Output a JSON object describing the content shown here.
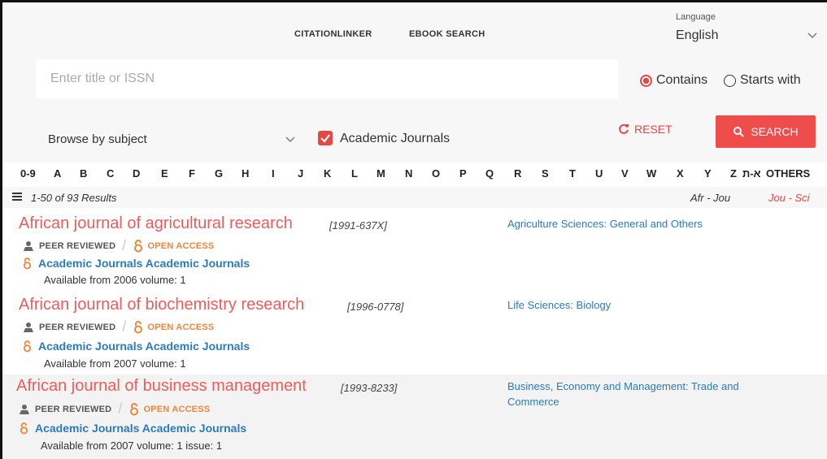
{
  "topnav": {
    "citationlinker": "CITATIONLINKER",
    "ebook_search": "EBOOK SEARCH"
  },
  "language": {
    "label": "Language",
    "value": "English"
  },
  "search": {
    "placeholder": "Enter title or ISSN",
    "radio_contains": "Contains",
    "radio_starts": "Starts with",
    "selected": "Contains"
  },
  "filters": {
    "subject_label": "Browse by subject",
    "academic_journals": "Academic Journals",
    "academic_checked": true
  },
  "actions": {
    "reset": "RESET",
    "search": "SEARCH"
  },
  "alphabet": [
    "0-9",
    "A",
    "B",
    "C",
    "D",
    "E",
    "F",
    "G",
    "H",
    "I",
    "J",
    "K",
    "L",
    "M",
    "N",
    "O",
    "P",
    "Q",
    "R",
    "S",
    "T",
    "U",
    "V",
    "W",
    "X",
    "Y",
    "Z",
    "א-ת",
    "OTHERS"
  ],
  "results": {
    "count": "1-50 of 93 Results",
    "range_current": "Afr - Jou",
    "range_next": "Jou - Sci",
    "items": [
      {
        "title": "African journal of agricultural research",
        "issn": "[1991-637X]",
        "subject": "Agriculture Sciences: General and Others",
        "peer": "PEER REVIEWED",
        "oa": "OPEN ACCESS",
        "provider": "Academic Journals Academic Journals",
        "availability": "Available from 2006 volume: 1"
      },
      {
        "title": "African journal of biochemistry research",
        "issn": "[1996-0778]",
        "subject": "Life Sciences: Biology",
        "peer": "PEER REVIEWED",
        "oa": "OPEN ACCESS",
        "provider": "Academic Journals Academic Journals",
        "availability": "Available from 2007 volume: 1"
      },
      {
        "title": "African journal of business management",
        "issn": "[1993-8233]",
        "subject": "Business, Economy and Management: Trade and Commerce",
        "peer": "PEER REVIEWED",
        "oa": "OPEN ACCESS",
        "provider": "Academic Journals Academic Journals",
        "availability": "Available from 2007 volume: 1 issue: 1"
      }
    ]
  },
  "colors": {
    "accent": "#ef4c4c",
    "link": "#2a7bbf",
    "open_access": "#f0853a"
  }
}
